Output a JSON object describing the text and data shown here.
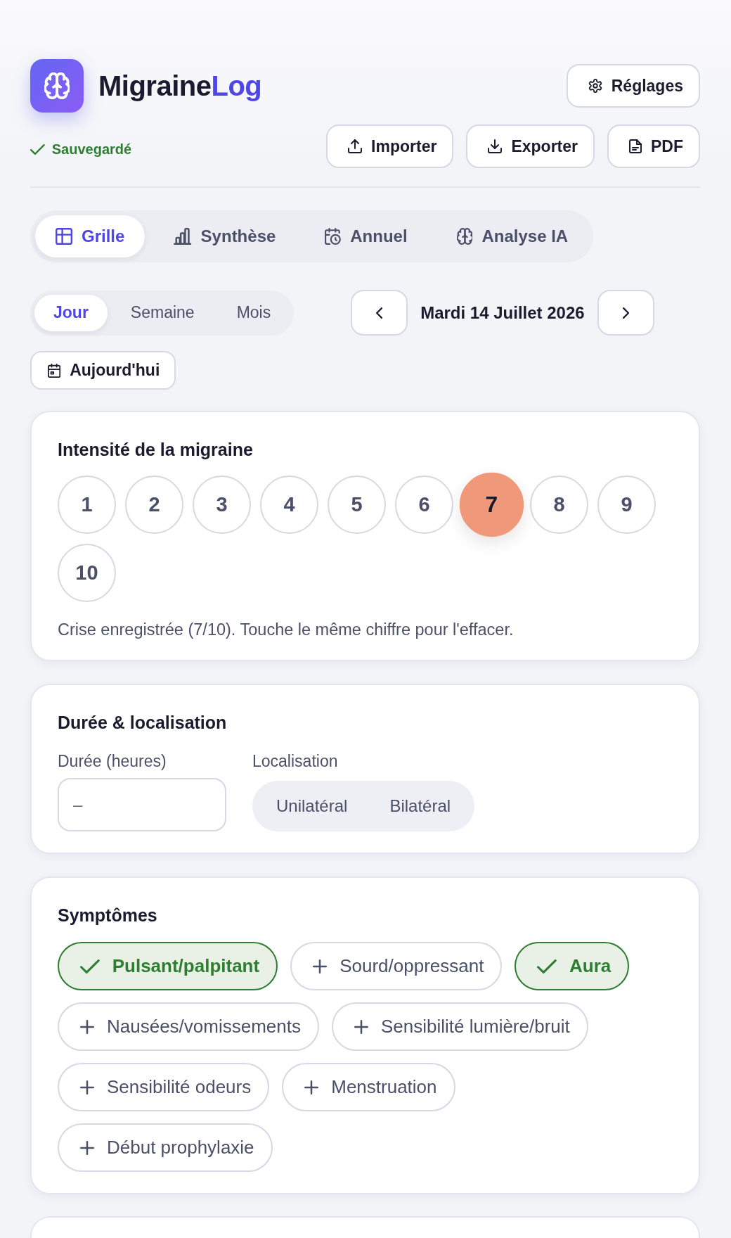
{
  "header": {
    "app_title": {
      "text": "Migraine",
      "accent": "Log"
    },
    "save_status": "Sauvegardé",
    "settings_button": "Réglages",
    "actions": [
      {
        "kind": "import",
        "label": "Importer"
      },
      {
        "kind": "export",
        "label": "Exporter"
      },
      {
        "kind": "pdf",
        "label": "PDF"
      }
    ]
  },
  "tabs": [
    {
      "kind": "grid",
      "label": "Grille",
      "selected": true
    },
    {
      "kind": "chart",
      "label": "Synthèse",
      "selected": false
    },
    {
      "kind": "calendar",
      "label": "Annuel",
      "selected": false
    },
    {
      "kind": "ai",
      "label": "Analyse IA",
      "selected": false
    }
  ],
  "period": {
    "modes": [
      {
        "label": "Jour",
        "selected": true
      },
      {
        "label": "Semaine",
        "selected": false
      },
      {
        "label": "Mois",
        "selected": false
      }
    ],
    "date": "Mardi 14 Juillet 2026",
    "today_button": "Aujourd'hui"
  },
  "intensity": {
    "title": "Intensité de la migraine",
    "levels": [
      {
        "label": "1",
        "selected": false
      },
      {
        "label": "2",
        "selected": false
      },
      {
        "label": "3",
        "selected": false
      },
      {
        "label": "4",
        "selected": false
      },
      {
        "label": "5",
        "selected": false
      },
      {
        "label": "6",
        "selected": false
      },
      {
        "label": "7",
        "selected": true
      },
      {
        "label": "8",
        "selected": false
      },
      {
        "label": "9",
        "selected": false
      },
      {
        "label": "10",
        "selected": false
      }
    ],
    "hint": "Crise enregistrée (7/10). Touche le même chiffre pour l'effacer."
  },
  "duration_location": {
    "title": "Durée & localisation",
    "duration": {
      "label": "Durée (heures)",
      "placeholder": "–"
    },
    "location": {
      "label": "Localisation",
      "options": [
        {
          "label": "Unilatéral",
          "selected": false
        },
        {
          "label": "Bilatéral",
          "selected": false
        }
      ]
    }
  },
  "symptoms": {
    "title": "Symptômes",
    "items": [
      {
        "label": "Pulsant/palpitant",
        "selected": true
      },
      {
        "label": "Sourd/oppressant",
        "selected": false
      },
      {
        "label": "Aura",
        "selected": true
      },
      {
        "label": "Nausées/vomissements",
        "selected": false
      },
      {
        "label": "Sensibilité lumière/bruit",
        "selected": false
      },
      {
        "label": "Sensibilité odeurs",
        "selected": false
      },
      {
        "label": "Menstruation",
        "selected": false
      },
      {
        "label": "Début prophylaxie",
        "selected": false
      }
    ]
  }
}
